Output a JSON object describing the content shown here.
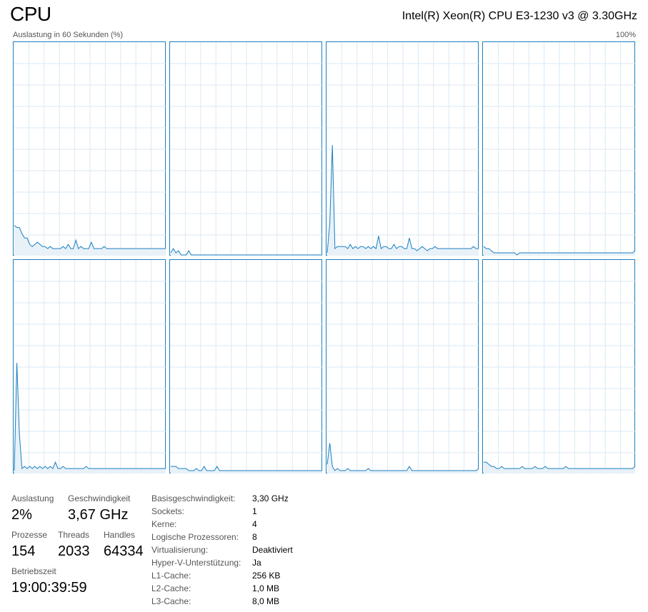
{
  "header": {
    "title": "CPU",
    "cpu_model": "Intel(R) Xeon(R) CPU E3-1230 v3 @ 3.30GHz",
    "graph_caption": "Auslastung in 60 Sekunden (%)",
    "graph_max": "100%"
  },
  "colors": {
    "line": "#1a7fbf",
    "fill": "#e8f1f8",
    "grid": "#d9eaf5",
    "border": "#1a7fbf"
  },
  "cores": [
    [
      14,
      13,
      13,
      10,
      8,
      8,
      5,
      4,
      5,
      6,
      5,
      4,
      4,
      3,
      4,
      3,
      3,
      3,
      3,
      4,
      3,
      5,
      3,
      3,
      7,
      3,
      4,
      3,
      3,
      3,
      6,
      3,
      3,
      3,
      3,
      4,
      3,
      3,
      3,
      3,
      3,
      3,
      3,
      3,
      3,
      3,
      3,
      3,
      3,
      3,
      3,
      3,
      3,
      3,
      3,
      3,
      3,
      3,
      3,
      3
    ],
    [
      1,
      3,
      1,
      2,
      0,
      0,
      0,
      2,
      0,
      0,
      0,
      0,
      0,
      0,
      0,
      0,
      0,
      0,
      0,
      0,
      0,
      0,
      0,
      0,
      0,
      0,
      0,
      0,
      0,
      0,
      0,
      0,
      0,
      0,
      0,
      0,
      0,
      0,
      0,
      0,
      0,
      0,
      0,
      0,
      0,
      0,
      0,
      0,
      0,
      0,
      0,
      0,
      0,
      0,
      0,
      0,
      0,
      0,
      0,
      0
    ],
    [
      1,
      15,
      52,
      3,
      4,
      4,
      4,
      4,
      3,
      5,
      3,
      4,
      3,
      4,
      4,
      3,
      4,
      3,
      4,
      3,
      9,
      3,
      4,
      4,
      3,
      3,
      5,
      3,
      4,
      4,
      3,
      3,
      8,
      3,
      3,
      2,
      3,
      4,
      3,
      2,
      3,
      3,
      4,
      3,
      3,
      3,
      3,
      3,
      3,
      3,
      3,
      3,
      3,
      3,
      3,
      3,
      3,
      4,
      3,
      3
    ],
    [
      4,
      3,
      3,
      2,
      1,
      1,
      1,
      1,
      1,
      1,
      1,
      1,
      1,
      0,
      1,
      1,
      1,
      1,
      1,
      1,
      1,
      1,
      1,
      1,
      1,
      1,
      1,
      1,
      1,
      1,
      1,
      1,
      1,
      1,
      1,
      1,
      1,
      1,
      1,
      1,
      1,
      1,
      1,
      1,
      1,
      1,
      1,
      1,
      1,
      1,
      1,
      1,
      1,
      1,
      1,
      1,
      1,
      1,
      1,
      2
    ],
    [
      1,
      52,
      18,
      2,
      3,
      2,
      3,
      2,
      3,
      2,
      3,
      2,
      3,
      2,
      3,
      2,
      5,
      2,
      2,
      3,
      2,
      2,
      2,
      2,
      2,
      2,
      2,
      2,
      3,
      2,
      2,
      2,
      2,
      2,
      2,
      2,
      2,
      2,
      2,
      2,
      2,
      2,
      2,
      2,
      2,
      2,
      2,
      2,
      2,
      2,
      2,
      2,
      2,
      2,
      2,
      2,
      2,
      2,
      2,
      2
    ],
    [
      3,
      3,
      3,
      2,
      2,
      2,
      2,
      1,
      1,
      1,
      2,
      1,
      1,
      3,
      1,
      1,
      1,
      1,
      3,
      1,
      1,
      1,
      1,
      1,
      1,
      1,
      1,
      1,
      1,
      1,
      1,
      1,
      1,
      1,
      1,
      1,
      1,
      1,
      1,
      1,
      1,
      1,
      1,
      1,
      1,
      1,
      1,
      1,
      1,
      1,
      1,
      1,
      1,
      1,
      1,
      1,
      1,
      1,
      1,
      1
    ],
    [
      4,
      14,
      3,
      1,
      2,
      1,
      1,
      1,
      2,
      1,
      1,
      1,
      1,
      1,
      1,
      1,
      2,
      1,
      1,
      1,
      1,
      1,
      1,
      1,
      1,
      1,
      1,
      1,
      1,
      1,
      1,
      1,
      3,
      1,
      1,
      1,
      1,
      1,
      1,
      1,
      1,
      1,
      1,
      1,
      1,
      1,
      1,
      1,
      1,
      1,
      1,
      1,
      1,
      1,
      1,
      1,
      1,
      1,
      1,
      2
    ],
    [
      5,
      5,
      4,
      3,
      3,
      2,
      2,
      3,
      2,
      2,
      2,
      2,
      2,
      2,
      2,
      3,
      2,
      2,
      2,
      2,
      3,
      2,
      2,
      2,
      3,
      2,
      2,
      2,
      2,
      2,
      2,
      2,
      3,
      2,
      2,
      2,
      2,
      2,
      2,
      2,
      2,
      2,
      2,
      2,
      2,
      2,
      2,
      2,
      2,
      2,
      2,
      2,
      2,
      2,
      2,
      2,
      2,
      2,
      2,
      3
    ]
  ],
  "stats": {
    "auslastung": {
      "label": "Auslastung",
      "value": "2%"
    },
    "geschwindigkeit": {
      "label": "Geschwindigkeit",
      "value": "3,67 GHz"
    },
    "prozesse": {
      "label": "Prozesse",
      "value": "154"
    },
    "threads": {
      "label": "Threads",
      "value": "2033"
    },
    "handles": {
      "label": "Handles",
      "value": "64334"
    },
    "betriebszeit": {
      "label": "Betriebszeit",
      "value": "19:00:39:59"
    }
  },
  "details": [
    {
      "label": "Basisgeschwindigkeit:",
      "value": "3,30 GHz"
    },
    {
      "label": "Sockets:",
      "value": "1"
    },
    {
      "label": "Kerne:",
      "value": "4"
    },
    {
      "label": "Logische Prozessoren:",
      "value": "8"
    },
    {
      "label": "Virtualisierung:",
      "value": "Deaktiviert"
    },
    {
      "label": "Hyper-V-Unterstützung:",
      "value": "Ja"
    },
    {
      "label": "L1-Cache:",
      "value": "256 KB"
    },
    {
      "label": "L2-Cache:",
      "value": "1,0 MB"
    },
    {
      "label": "L3-Cache:",
      "value": "8,0 MB"
    }
  ]
}
